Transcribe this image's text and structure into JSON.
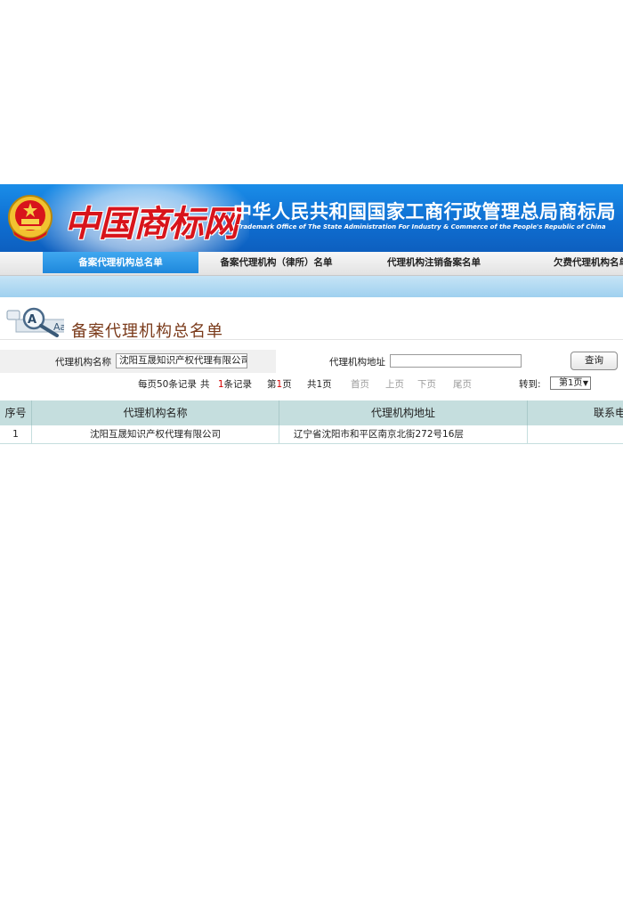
{
  "header": {
    "logo_text": "中国商标网",
    "title_cn": "中华人民共和国国家工商行政管理总局商标局",
    "title_en": "Trademark Office of The State Administration For Industry & Commerce of the People's Republic of China",
    "emblem_icon": "national-emblem-icon",
    "colors": {
      "banner": "#1a8de8",
      "logo": "#d8141b"
    }
  },
  "nav": {
    "items": [
      {
        "label": "备案代理机构总名单",
        "active": true
      },
      {
        "label": "备案代理机构（律所）名单",
        "active": false
      },
      {
        "label": "代理机构注销备案名单",
        "active": false
      },
      {
        "label": "欠费代理机构名单",
        "active": false
      }
    ],
    "active_color": "#1e88dc"
  },
  "page": {
    "title": "备案代理机构总名单",
    "title_icon": "magnifier-icon"
  },
  "search": {
    "name_label": "代理机构名称",
    "name_value": "沈阳互晟知识产权代理有限公司",
    "address_label": "代理机构地址",
    "address_value": "",
    "query_button": "查询"
  },
  "pagination": {
    "per_page_text": "每页50条记录",
    "total_prefix": "共",
    "total_count": "1",
    "total_suffix": "条记录",
    "page_prefix": "第",
    "current_page": "1",
    "page_suffix": "页",
    "total_pages_text": "共1页",
    "first": "首页",
    "prev": "上页",
    "next": "下页",
    "last": "尾页",
    "jump_label": "转到:",
    "jump_selected": "第1页"
  },
  "table": {
    "columns": [
      "序号",
      "代理机构名称",
      "代理机构地址",
      "联系电话"
    ],
    "rows": [
      [
        "1",
        "沈阳互晟知识产权代理有限公司",
        "辽宁省沈阳市和平区南京北街272号16层",
        ""
      ]
    ],
    "header_color": "#c5dede"
  }
}
